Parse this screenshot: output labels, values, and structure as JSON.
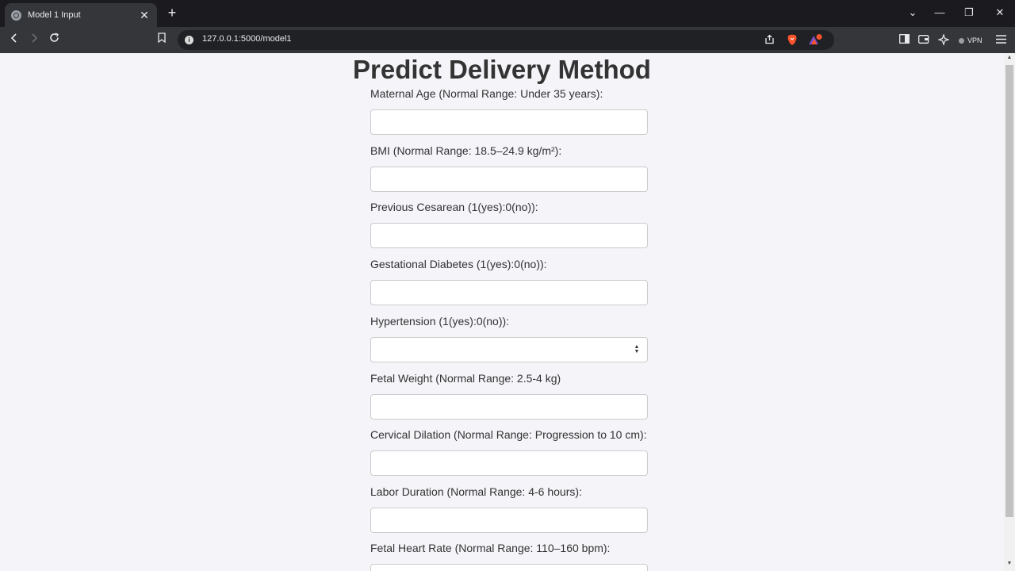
{
  "browser": {
    "tab_title": "Model 1 Input",
    "tab_close": "✕",
    "new_tab": "+",
    "url": "127.0.0.1:5000/model1",
    "vpn_label": "VPN",
    "window_controls": [
      "⌄",
      "—",
      "❐",
      "✕"
    ]
  },
  "page": {
    "heading": "Predict Delivery Method",
    "fields": [
      {
        "label": "Maternal Age (Normal Range: Under 35 years):",
        "type": "input",
        "value": ""
      },
      {
        "label": "BMI (Normal Range: 18.5–24.9 kg/m²):",
        "type": "input",
        "value": ""
      },
      {
        "label": "Previous Cesarean (1(yes):0(no)):",
        "type": "input",
        "value": ""
      },
      {
        "label": "Gestational Diabetes (1(yes):0(no)):",
        "type": "input",
        "value": ""
      },
      {
        "label": "Hypertension (1(yes):0(no)):",
        "type": "select",
        "value": ""
      },
      {
        "label": "Fetal Weight (Normal Range: 2.5-4 kg)",
        "type": "input",
        "value": ""
      },
      {
        "label": "Cervical Dilation (Normal Range: Progression to 10 cm):",
        "type": "input",
        "value": ""
      },
      {
        "label": "Labor Duration (Normal Range: 4-6 hours):",
        "type": "input",
        "value": ""
      },
      {
        "label": "Fetal Heart Rate (Normal Range: 110–160 bpm):",
        "type": "input",
        "value": ""
      }
    ]
  },
  "colors": {
    "page_background": "#f4f4f9",
    "heading_text": "#333333",
    "input_border": "#cccccc",
    "brave_orange": "#fb542b"
  }
}
